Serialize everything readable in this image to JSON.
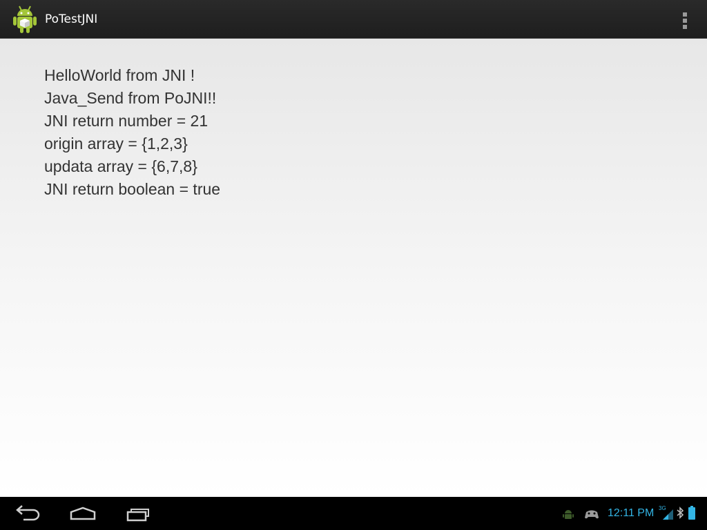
{
  "app": {
    "title": "PoTestJNI",
    "icon": "android-robot-icon"
  },
  "action_bar": {
    "overflow_icon": "overflow-menu-icon"
  },
  "content": {
    "lines": [
      "HelloWorld from JNI !",
      "Java_Send from PoJNI!!",
      "JNI return number = 21",
      "origin array = {1,2,3}",
      "updata array = {6,7,8}",
      "JNI return boolean = true"
    ]
  },
  "system_bar": {
    "nav": [
      "back-icon",
      "home-icon",
      "recent-apps-icon"
    ],
    "notifications": [
      "android-debug-icon",
      "game-controller-icon"
    ],
    "clock": "12:11 PM",
    "signal_type": "3G",
    "status_icons": [
      "signal-icon",
      "bluetooth-icon",
      "battery-icon"
    ],
    "colors": {
      "accent": "#33b5e5",
      "action_bar": "#222222",
      "text": "#333333"
    }
  }
}
